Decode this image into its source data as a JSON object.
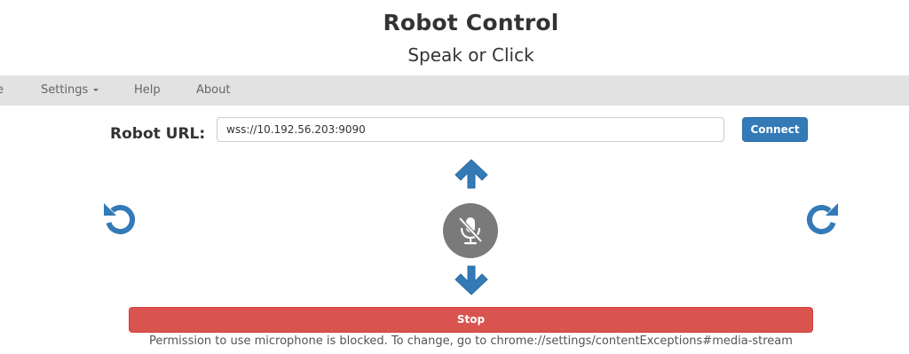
{
  "header": {
    "title": "Robot Control",
    "subtitle": "Speak or Click"
  },
  "navbar": {
    "items": [
      {
        "label": "e",
        "icon": null
      },
      {
        "label": "Settings",
        "has_dropdown": true
      },
      {
        "label": "Help"
      },
      {
        "label": "About"
      }
    ]
  },
  "connection": {
    "label": "Robot URL:",
    "url_value": "wss://10.192.56.203:9090",
    "connect_label": "Connect"
  },
  "controls": {
    "forward_icon": "arrow-up-icon",
    "backward_icon": "arrow-down-icon",
    "rotate_left_icon": "rotate-left-icon",
    "rotate_right_icon": "rotate-right-icon",
    "mic_icon": "microphone-slash-icon",
    "stop_label": "Stop"
  },
  "status": {
    "permission_message": "Permission to use microphone is blocked. To change, go to chrome://settings/contentExceptions#media-stream"
  },
  "colors": {
    "accent": "#337ab7",
    "danger": "#d9534f",
    "navbar_bg": "#e2e2e2",
    "mic_bg": "#7a7a7a"
  }
}
